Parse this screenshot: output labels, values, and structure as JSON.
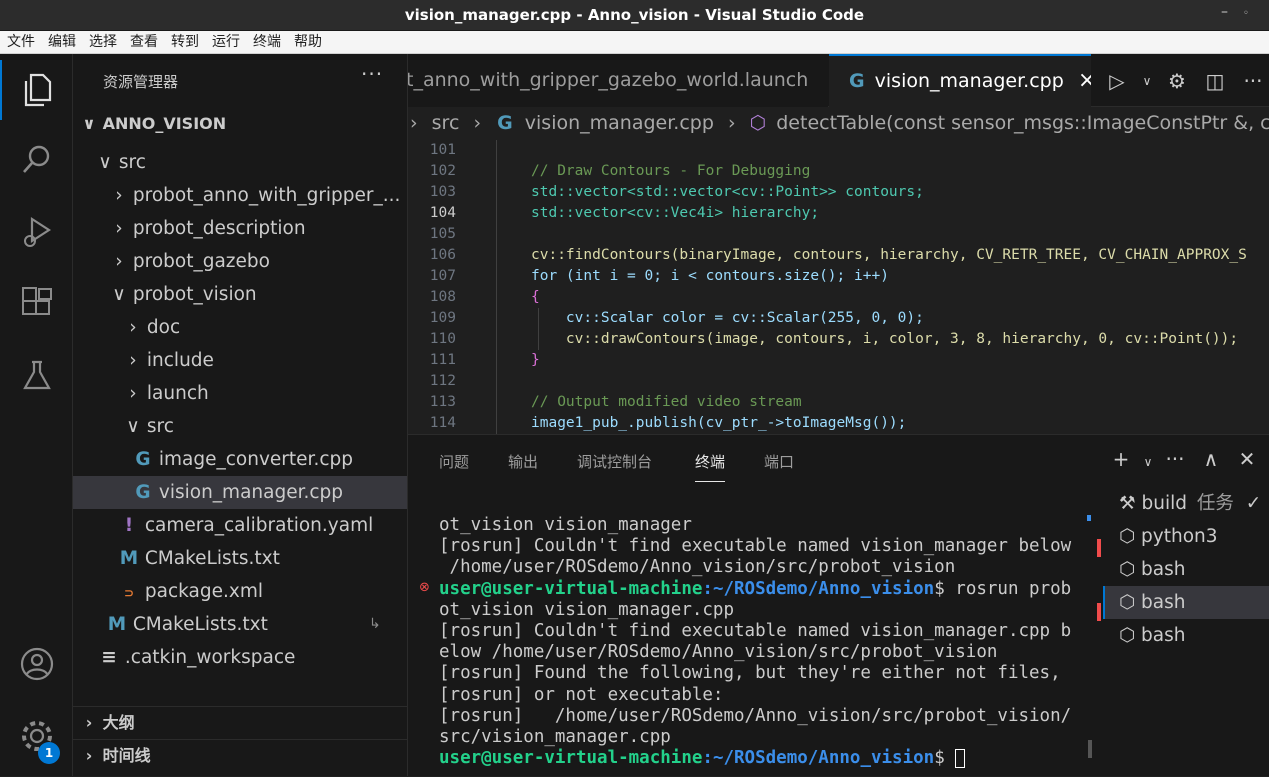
{
  "window": {
    "title": "vision_manager.cpp - Anno_vision - Visual Studio Code"
  },
  "menu": [
    "文件",
    "编辑",
    "选择",
    "查看",
    "转到",
    "运行",
    "终端",
    "帮助"
  ],
  "activity_bar": {
    "badge": "1"
  },
  "explorer": {
    "title": "资源管理器",
    "more": "···",
    "root": "ANNO_VISION",
    "tree": [
      {
        "label": "src",
        "chev": "∨"
      },
      {
        "label": "probot_anno_with_gripper_...",
        "chev": "›"
      },
      {
        "label": "probot_description",
        "chev": "›"
      },
      {
        "label": "probot_gazebo",
        "chev": "›"
      },
      {
        "label": "probot_vision",
        "chev": "∨"
      },
      {
        "label": "doc",
        "chev": "›"
      },
      {
        "label": "include",
        "chev": "›"
      },
      {
        "label": "launch",
        "chev": "›"
      },
      {
        "label": "src",
        "chev": "∨"
      },
      {
        "label": "image_converter.cpp",
        "icon": "G"
      },
      {
        "label": "vision_manager.cpp",
        "icon": "G"
      },
      {
        "label": "camera_calibration.yaml",
        "icon": "!"
      },
      {
        "label": "CMakeLists.txt",
        "icon": "M"
      },
      {
        "label": "package.xml",
        "icon": "rss"
      },
      {
        "label": "CMakeLists.txt",
        "icon": "M"
      },
      {
        "label": ".catkin_workspace",
        "icon": "≡"
      }
    ],
    "sections": [
      "大纲",
      "时间线"
    ]
  },
  "tabs": [
    {
      "label": "t_anno_with_gripper_gazebo_world.launch"
    },
    {
      "label": "vision_manager.cpp",
      "close": "×"
    }
  ],
  "breadcrumb": {
    "parts": [
      "src",
      "vision_manager.cpp",
      "detectTable(const sensor_msgs::ImageConstPtr &, cv::Rect &"
    ]
  },
  "editor": {
    "current_line": "104",
    "lines": [
      {
        "n": "101",
        "code": ""
      },
      {
        "n": "102",
        "code": "// Draw Contours - For Debugging"
      },
      {
        "n": "103",
        "code": "std::vector<std::vector<cv::Point>> contours;"
      },
      {
        "n": "104",
        "code": "std::vector<cv::Vec4i> hierarchy;"
      },
      {
        "n": "105",
        "code": ""
      },
      {
        "n": "106",
        "code": "cv::findContours(binaryImage, contours, hierarchy, CV_RETR_TREE, CV_CHAIN_APPROX_S"
      },
      {
        "n": "107",
        "code": "for (int i = 0; i < contours.size(); i++)"
      },
      {
        "n": "108",
        "code": "{"
      },
      {
        "n": "109",
        "code": "    cv::Scalar color = cv::Scalar(255, 0, 0);"
      },
      {
        "n": "110",
        "code": "    cv::drawContours(image, contours, i, color, 3, 8, hierarchy, 0, cv::Point());"
      },
      {
        "n": "111",
        "code": "}"
      },
      {
        "n": "112",
        "code": ""
      },
      {
        "n": "113",
        "code": "// Output modified video stream"
      },
      {
        "n": "114",
        "code": "image1_pub_.publish(cv_ptr_->toImageMsg());"
      }
    ]
  },
  "panel": {
    "tabs": [
      "问题",
      "输出",
      "调试控制台",
      "终端",
      "端口"
    ],
    "active_tab": "终端",
    "terminal": {
      "lines": [
        "ot_vision vision_manager",
        "[rosrun] Couldn't find executable named vision_manager below",
        " /home/user/ROSdemo/Anno_vision/src/probot_vision",
        "",
        "ot_vision vision_manager.cpp",
        "[rosrun] Couldn't find executable named vision_manager.cpp b",
        "elow /home/user/ROSdemo/Anno_vision/src/probot_vision",
        "[rosrun] Found the following, but they're either not files,",
        "[rosrun] or not executable:",
        "[rosrun]   /home/user/ROSdemo/Anno_vision/src/probot_vision/",
        "src/vision_manager.cpp"
      ],
      "prompt_user": "user@user-virtual-machine",
      "prompt_path": ":~/ROSdemo/Anno_vision",
      "prompt_sign": "$",
      "cmd": " rosrun prob",
      "err_mark": "⊗"
    },
    "term_list": [
      {
        "label": "build",
        "extra": "任务"
      },
      {
        "label": "python3"
      },
      {
        "label": "bash"
      },
      {
        "label": "bash"
      },
      {
        "label": "bash"
      }
    ]
  }
}
